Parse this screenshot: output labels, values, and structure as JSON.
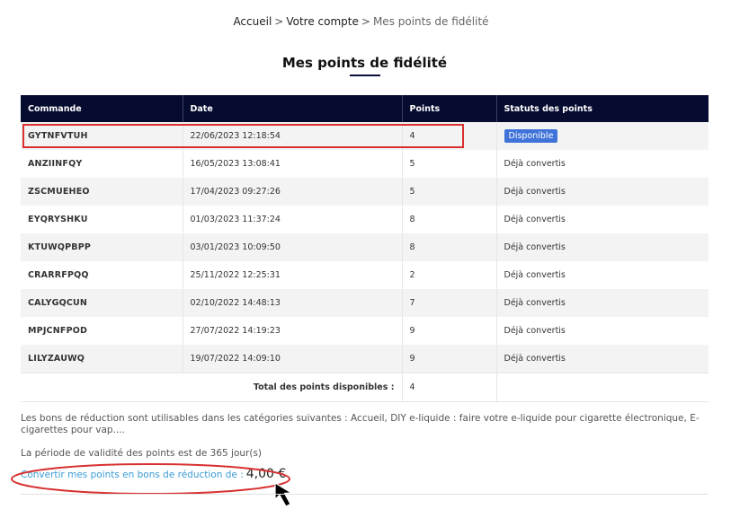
{
  "breadcrumb": {
    "home": "Accueil",
    "account": "Votre compte",
    "current": "Mes points de fidélité",
    "separator": ">"
  },
  "page_title": "Mes points de fidélité",
  "table": {
    "headers": [
      "Commande",
      "Date",
      "Points",
      "Statuts des points"
    ],
    "rows": [
      {
        "order": "GYTNFVTUH",
        "date": "22/06/2023 12:18:54",
        "points": "4",
        "status": "Disponible",
        "status_badge": true
      },
      {
        "order": "ANZIINFQY",
        "date": "16/05/2023 13:08:41",
        "points": "5",
        "status": "Déjà convertis",
        "status_badge": false
      },
      {
        "order": "ZSCMUEHEO",
        "date": "17/04/2023 09:27:26",
        "points": "5",
        "status": "Déjà convertis",
        "status_badge": false
      },
      {
        "order": "EYQRYSHKU",
        "date": "01/03/2023 11:37:24",
        "points": "8",
        "status": "Déjà convertis",
        "status_badge": false
      },
      {
        "order": "KTUWQPBPP",
        "date": "03/01/2023 10:09:50",
        "points": "8",
        "status": "Déjà convertis",
        "status_badge": false
      },
      {
        "order": "CRARRFPQQ",
        "date": "25/11/2022 12:25:31",
        "points": "2",
        "status": "Déjà convertis",
        "status_badge": false
      },
      {
        "order": "CALYGQCUN",
        "date": "02/10/2022 14:48:13",
        "points": "7",
        "status": "Déjà convertis",
        "status_badge": false
      },
      {
        "order": "MPJCNFPOD",
        "date": "27/07/2022 14:19:23",
        "points": "9",
        "status": "Déjà convertis",
        "status_badge": false
      },
      {
        "order": "LILYZAUWQ",
        "date": "19/07/2022 14:09:10",
        "points": "9",
        "status": "Déjà convertis",
        "status_badge": false
      }
    ],
    "total_label": "Total des points disponibles :",
    "total_value": "4"
  },
  "info": {
    "categories": "Les bons de réduction sont utilisables dans les catégories suivantes : Accueil, DIY e-liquide : faire votre e-liquide pour cigarette électronique, E-cigarettes pour vap....",
    "validity": "La période de validité des points est de 365 jour(s)"
  },
  "convert": {
    "label": "Convertir mes points en bons de réduction de :",
    "amount": "4,00 €"
  },
  "colors": {
    "header_bg": "#060b30",
    "badge_bg": "#3f73d9",
    "link": "#3a9bd6",
    "annotation_red": "#d83030"
  },
  "icons": {
    "cursor": "arrow-cursor-icon"
  }
}
